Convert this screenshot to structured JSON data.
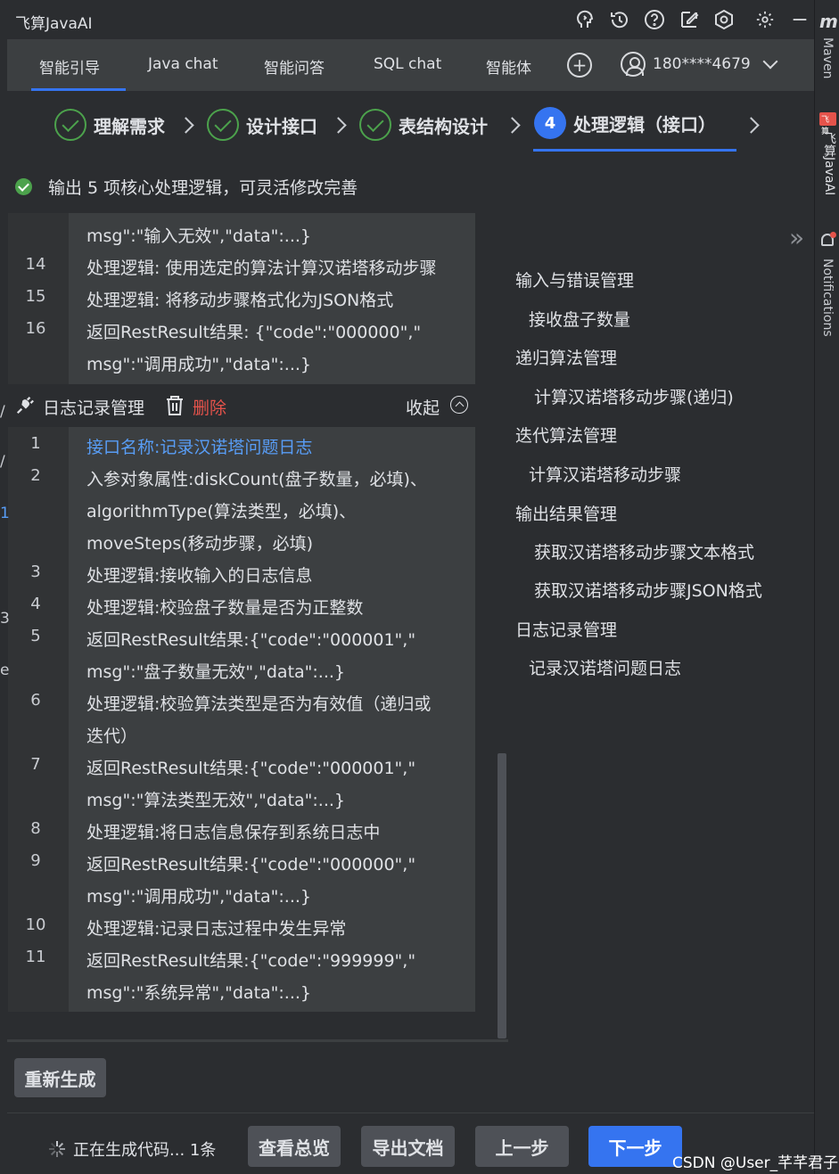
{
  "app": {
    "title": "飞算JavaAI"
  },
  "tabs": [
    {
      "label": "智能引导",
      "active": true
    },
    {
      "label": "Java chat"
    },
    {
      "label": "智能问答"
    },
    {
      "label": "SQL chat"
    },
    {
      "label": "智能体"
    }
  ],
  "user": {
    "phone": "180****4679"
  },
  "steps": [
    {
      "label": "理解需求",
      "status": "done"
    },
    {
      "label": "设计接口",
      "status": "done"
    },
    {
      "label": "表结构设计",
      "status": "done"
    },
    {
      "number": "4",
      "label": "处理逻辑（接口）",
      "status": "active"
    }
  ],
  "status": {
    "text": "输出 5 项核心处理逻辑，可灵活修改完善"
  },
  "top_code": {
    "lines": [
      {
        "num": "",
        "text": "msg\":\"输入无效\",\"data\":...}"
      },
      {
        "num": "14",
        "text": "处理逻辑: 使用选定的算法计算汉诺塔移动步骤"
      },
      {
        "num": "15",
        "text": "处理逻辑: 将移动步骤格式化为JSON格式"
      },
      {
        "num": "16",
        "text": "返回RestResult结果: {\"code\":\"000000\",\""
      },
      {
        "num": "",
        "text": "msg\":\"调用成功\",\"data\":...}"
      }
    ]
  },
  "section": {
    "title": "日志记录管理",
    "delete_label": "删除",
    "collapse_label": "收起"
  },
  "log_code": {
    "lines": [
      {
        "num": "1",
        "text": "接口名称:记录汉诺塔问题日志",
        "highlight": true
      },
      {
        "num": "2",
        "text": "入参对象属性:diskCount(盘子数量，必填)、"
      },
      {
        "num": "",
        "text": "algorithmType(算法类型，必填)、"
      },
      {
        "num": "",
        "text": "moveSteps(移动步骤，必填)"
      },
      {
        "num": "3",
        "text": "处理逻辑:接收输入的日志信息"
      },
      {
        "num": "4",
        "text": "处理逻辑:校验盘子数量是否为正整数"
      },
      {
        "num": "5",
        "text": "返回RestResult结果:{\"code\":\"000001\",\""
      },
      {
        "num": "",
        "text": "msg\":\"盘子数量无效\",\"data\":...}"
      },
      {
        "num": "6",
        "text": "处理逻辑:校验算法类型是否为有效值（递归或"
      },
      {
        "num": "",
        "text": "迭代）"
      },
      {
        "num": "7",
        "text": "返回RestResult结果:{\"code\":\"000001\",\""
      },
      {
        "num": "",
        "text": "msg\":\"算法类型无效\",\"data\":...}"
      },
      {
        "num": "8",
        "text": "处理逻辑:将日志信息保存到系统日志中"
      },
      {
        "num": "9",
        "text": "返回RestResult结果:{\"code\":\"000000\",\""
      },
      {
        "num": "",
        "text": "msg\":\"调用成功\",\"data\":...}"
      },
      {
        "num": "10",
        "text": "处理逻辑:记录日志过程中发生异常"
      },
      {
        "num": "11",
        "text": "返回RestResult结果:{\"code\":\"999999\",\""
      },
      {
        "num": "",
        "text": "msg\":\"系统异常\",\"data\":...}"
      }
    ]
  },
  "outline": [
    {
      "label": "输入与错误管理",
      "level": 1
    },
    {
      "label": "接收盘子数量",
      "level": 2
    },
    {
      "label": "递归算法管理",
      "level": 1
    },
    {
      "label": "计算汉诺塔移动步骤(递归)",
      "level": 2
    },
    {
      "label": "迭代算法管理",
      "level": 1
    },
    {
      "label": "计算汉诺塔移动步骤",
      "level": 2
    },
    {
      "label": "输出结果管理",
      "level": 1
    },
    {
      "label": "获取汉诺塔移动步骤文本格式",
      "level": 2
    },
    {
      "label": "获取汉诺塔移动步骤JSON格式",
      "level": 2
    },
    {
      "label": "日志记录管理",
      "level": 1
    },
    {
      "label": "记录汉诺塔问题日志",
      "level": 2
    }
  ],
  "right_sidebar": {
    "maven": "Maven",
    "plugin": "飞算JavaAI",
    "notifications": "Notifications",
    "logo_text": "飞算"
  },
  "left_fragments": [
    "/",
    "/",
    "1",
    "3",
    "e"
  ],
  "bottom": {
    "regenerate": "重新生成",
    "progress_text": "正在生成代码... 1条",
    "overview": "查看总览",
    "export": "导出文档",
    "prev": "上一步",
    "next": "下一步"
  },
  "watermark": "CSDN @User_芊芊君子",
  "colors": {
    "accent": "#3574f0",
    "success": "#4ca24c",
    "danger": "#e5534b",
    "link": "#589df6"
  }
}
